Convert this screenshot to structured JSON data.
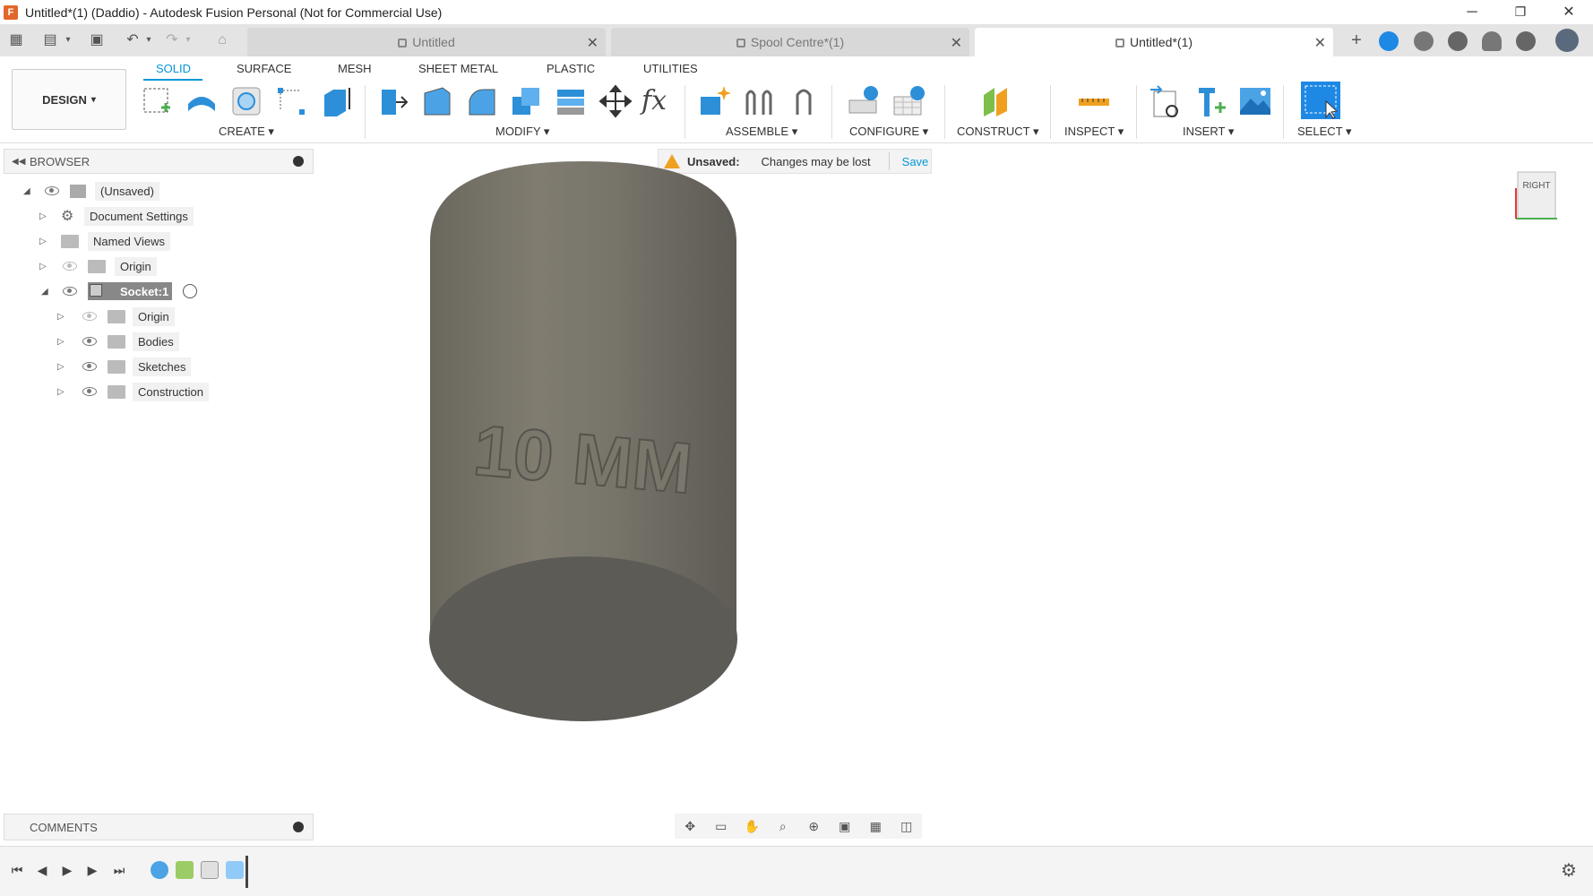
{
  "window": {
    "title": "Untitled*(1) (Daddio) - Autodesk Fusion Personal (Not for Commercial Use)",
    "logo_letter": "F",
    "minimize": "─",
    "restore": "❐",
    "close": "✕"
  },
  "doc_tabs": [
    {
      "label": "Untitled",
      "active": false
    },
    {
      "label": "Spool Centre*(1)",
      "active": false
    },
    {
      "label": "Untitled*(1)",
      "active": true
    }
  ],
  "toolbar": {
    "workspace": "DESIGN",
    "workspace_caret": "▾",
    "tabs": [
      "SOLID",
      "SURFACE",
      "MESH",
      "SHEET METAL",
      "PLASTIC",
      "UTILITIES"
    ],
    "active_tab": "SOLID",
    "groups": [
      "CREATE ▾",
      "MODIFY ▾",
      "ASSEMBLE ▾",
      "CONFIGURE ▾",
      "CONSTRUCT ▾",
      "INSPECT ▾",
      "INSERT ▾",
      "SELECT ▾"
    ]
  },
  "browser": {
    "title": "BROWSER",
    "items": [
      {
        "label": "(Unsaved)",
        "level": 0,
        "expanded": true,
        "visible": true
      },
      {
        "label": "Document Settings",
        "level": 1,
        "expanded": false,
        "icon": "gear-icon"
      },
      {
        "label": "Named Views",
        "level": 1,
        "expanded": false,
        "icon": "folder-icon"
      },
      {
        "label": "Origin",
        "level": 1,
        "expanded": false,
        "visible": false
      },
      {
        "label": "Socket:1",
        "level": 1,
        "expanded": true,
        "visible": true
      },
      {
        "label": "Origin",
        "level": 2,
        "expanded": false,
        "visible": false
      },
      {
        "label": "Bodies",
        "level": 2,
        "expanded": false,
        "visible": true
      },
      {
        "label": "Sketches",
        "level": 2,
        "expanded": false,
        "visible": true
      },
      {
        "label": "Construction",
        "level": 2,
        "expanded": false,
        "visible": true
      }
    ]
  },
  "unsaved_bar": {
    "label": "Unsaved:",
    "message": "Changes may be lost",
    "save": "Save"
  },
  "model": {
    "engraving": "10 MM",
    "body_color": "#6e6c62"
  },
  "viewcube": {
    "face": "RIGHT"
  },
  "comments": {
    "title": "COMMENTS"
  },
  "colors": {
    "accent": "#0696d7",
    "warning": "#f0a020"
  }
}
